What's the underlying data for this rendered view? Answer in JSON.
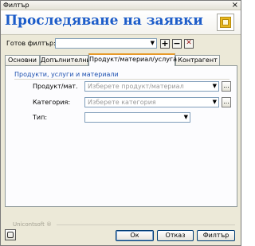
{
  "window": {
    "title": "Филтър",
    "close_symbol": "×"
  },
  "header": {
    "title": "Проследяване на заявки",
    "icon": "report-icon"
  },
  "filter": {
    "label": "Готов филтър:",
    "value": "",
    "add_symbol": "+",
    "remove_symbol": "−",
    "clear_symbol": "✕"
  },
  "tabs": [
    {
      "label": "Основни"
    },
    {
      "label": "Допълнителни"
    },
    {
      "label": "Продукт/материал/услуга",
      "active": true
    },
    {
      "label": "Контрагент"
    }
  ],
  "section": {
    "title": "Продукти, услуги и материали",
    "fields": [
      {
        "label": "Продукт/мат.",
        "placeholder": "Изберете продукт/материал",
        "has_browse": true
      },
      {
        "label": "Категория:",
        "placeholder": "Изберете категория",
        "has_browse": true
      },
      {
        "label": "Тип:",
        "placeholder": "",
        "has_browse": false
      }
    ]
  },
  "footer": {
    "brand": "Unicontsoft ®",
    "ok_label": "Ок",
    "cancel_label": "Отказ",
    "filter_label": "Филтър"
  },
  "colors": {
    "title_blue": "#1c5cc9",
    "tab_accent": "#e79a2a",
    "section_blue": "#1c4fb0"
  }
}
